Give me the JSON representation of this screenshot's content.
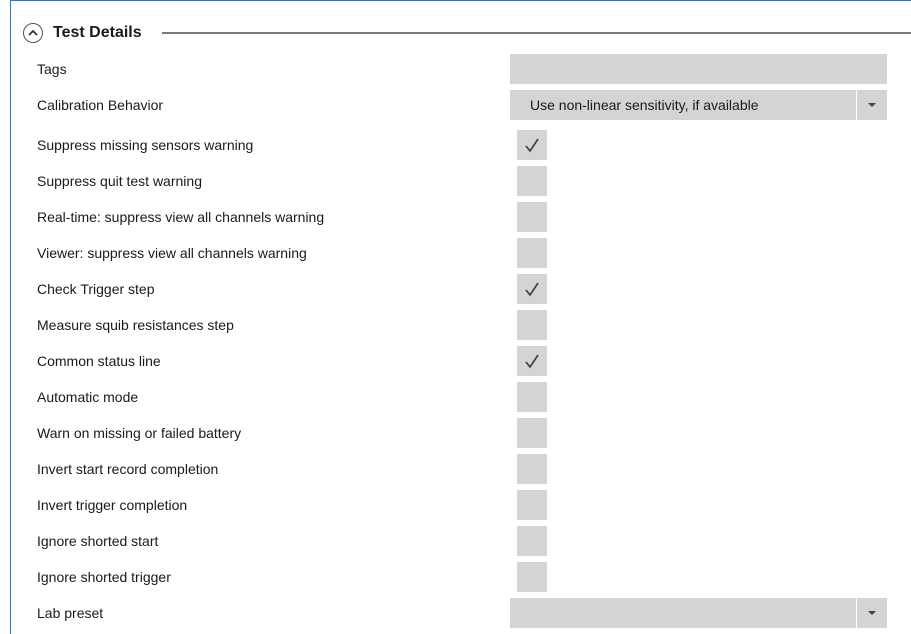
{
  "section": {
    "title": "Test Details",
    "expanded": true
  },
  "fields": {
    "tags": {
      "label": "Tags",
      "value": ""
    },
    "calibration_behavior": {
      "label": "Calibration Behavior",
      "value": "Use non-linear sensitivity, if available"
    },
    "lab_preset": {
      "label": "Lab preset",
      "value": ""
    }
  },
  "checkboxes": [
    {
      "label": "Suppress missing sensors warning",
      "checked": true
    },
    {
      "label": "Suppress quit test warning",
      "checked": false
    },
    {
      "label": "Real-time: suppress view all channels warning",
      "checked": false
    },
    {
      "label": "Viewer: suppress view all channels warning",
      "checked": false
    },
    {
      "label": "Check Trigger step",
      "checked": true
    },
    {
      "label": "Measure squib resistances step",
      "checked": false
    },
    {
      "label": "Common status line",
      "checked": true
    },
    {
      "label": "Automatic mode",
      "checked": false
    },
    {
      "label": "Warn on missing or failed battery",
      "checked": false
    },
    {
      "label": "Invert start record completion",
      "checked": false
    },
    {
      "label": "Invert trigger completion",
      "checked": false
    },
    {
      "label": "Ignore shorted start",
      "checked": false
    },
    {
      "label": "Ignore shorted trigger",
      "checked": false
    }
  ],
  "icons": {
    "collapse": "chevron-up-icon",
    "dropdown": "caret-down-icon",
    "check": "checkmark-icon"
  },
  "colors": {
    "frame_border": "#2b78d4",
    "input_bg": "#d4d4d4"
  }
}
